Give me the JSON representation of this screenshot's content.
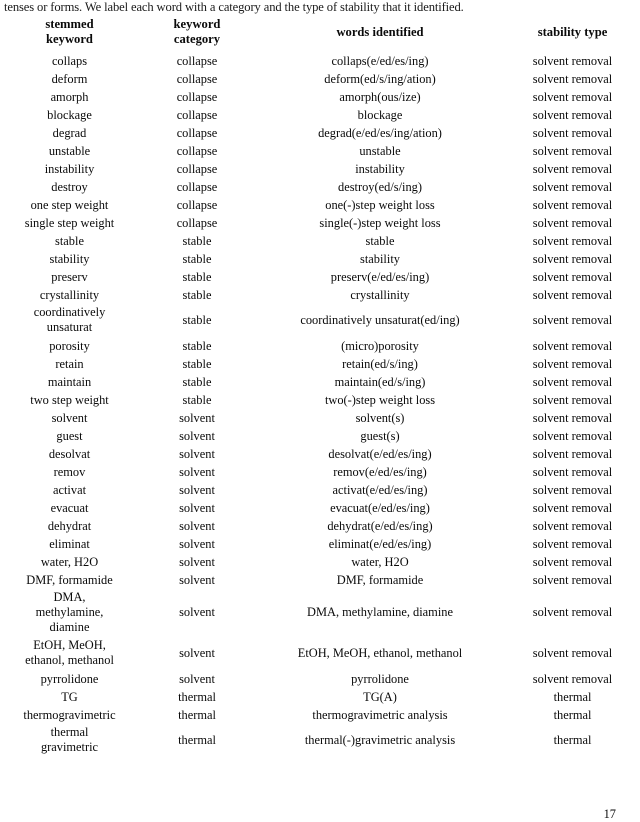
{
  "document": {
    "caption_text": "tenses or forms.  We label each word with a category and the type of stability that it identified.",
    "page_number": "17"
  },
  "table": {
    "columns": [
      {
        "key": "stemmed_keyword",
        "header": "stemmed\nkeyword"
      },
      {
        "key": "keyword_category",
        "header": "keyword\ncategory"
      },
      {
        "key": "words_identified",
        "header": "words identified"
      },
      {
        "key": "stability_type",
        "header": "stability type"
      }
    ],
    "groups": [
      {
        "name": "collapse",
        "rows": [
          {
            "stemmed_keyword": "collaps",
            "keyword_category": "collapse",
            "words_identified": "collaps(e/ed/es/ing)",
            "stability_type": "solvent removal"
          },
          {
            "stemmed_keyword": "deform",
            "keyword_category": "collapse",
            "words_identified": "deform(ed/s/ing/ation)",
            "stability_type": "solvent removal"
          },
          {
            "stemmed_keyword": "amorph",
            "keyword_category": "collapse",
            "words_identified": "amorph(ous/ize)",
            "stability_type": "solvent removal"
          },
          {
            "stemmed_keyword": "blockage",
            "keyword_category": "collapse",
            "words_identified": "blockage",
            "stability_type": "solvent removal"
          },
          {
            "stemmed_keyword": "degrad",
            "keyword_category": "collapse",
            "words_identified": "degrad(e/ed/es/ing/ation)",
            "stability_type": "solvent removal"
          },
          {
            "stemmed_keyword": "unstable",
            "keyword_category": "collapse",
            "words_identified": "unstable",
            "stability_type": "solvent removal"
          },
          {
            "stemmed_keyword": "instability",
            "keyword_category": "collapse",
            "words_identified": "instability",
            "stability_type": "solvent removal"
          },
          {
            "stemmed_keyword": "destroy",
            "keyword_category": "collapse",
            "words_identified": "destroy(ed/s/ing)",
            "stability_type": "solvent removal"
          },
          {
            "stemmed_keyword": "one step weight",
            "keyword_category": "collapse",
            "words_identified": "one(-)step weight loss",
            "stability_type": "solvent removal"
          },
          {
            "stemmed_keyword": "single step weight",
            "keyword_category": "collapse",
            "words_identified": "single(-)step weight loss",
            "stability_type": "solvent removal"
          }
        ]
      },
      {
        "name": "stable",
        "rows": [
          {
            "stemmed_keyword": "stable",
            "keyword_category": "stable",
            "words_identified": "stable",
            "stability_type": "solvent removal"
          },
          {
            "stemmed_keyword": "stability",
            "keyword_category": "stable",
            "words_identified": "stability",
            "stability_type": "solvent removal"
          },
          {
            "stemmed_keyword": "preserv",
            "keyword_category": "stable",
            "words_identified": "preserv(e/ed/es/ing)",
            "stability_type": "solvent removal"
          },
          {
            "stemmed_keyword": "crystallinity",
            "keyword_category": "stable",
            "words_identified": "crystallinity",
            "stability_type": "solvent removal"
          },
          {
            "stemmed_keyword": "coordinatively\nunsaturat",
            "keyword_category": "stable",
            "words_identified": "coordinatively unsaturat(ed/ing)",
            "stability_type": "solvent removal",
            "tall": true
          },
          {
            "stemmed_keyword": "porosity",
            "keyword_category": "stable",
            "words_identified": "(micro)porosity",
            "stability_type": "solvent removal"
          },
          {
            "stemmed_keyword": "retain",
            "keyword_category": "stable",
            "words_identified": "retain(ed/s/ing)",
            "stability_type": "solvent removal"
          },
          {
            "stemmed_keyword": "maintain",
            "keyword_category": "stable",
            "words_identified": "maintain(ed/s/ing)",
            "stability_type": "solvent removal"
          },
          {
            "stemmed_keyword": "two step weight",
            "keyword_category": "stable",
            "words_identified": "two(-)step weight loss",
            "stability_type": "solvent removal"
          }
        ]
      },
      {
        "name": "solvent",
        "rows": [
          {
            "stemmed_keyword": "solvent",
            "keyword_category": "solvent",
            "words_identified": "solvent(s)",
            "stability_type": "solvent removal"
          },
          {
            "stemmed_keyword": "guest",
            "keyword_category": "solvent",
            "words_identified": "guest(s)",
            "stability_type": "solvent removal"
          },
          {
            "stemmed_keyword": "desolvat",
            "keyword_category": "solvent",
            "words_identified": "desolvat(e/ed/es/ing)",
            "stability_type": "solvent removal"
          },
          {
            "stemmed_keyword": "remov",
            "keyword_category": "solvent",
            "words_identified": "remov(e/ed/es/ing)",
            "stability_type": "solvent removal"
          },
          {
            "stemmed_keyword": "activat",
            "keyword_category": "solvent",
            "words_identified": "activat(e/ed/es/ing)",
            "stability_type": "solvent removal"
          },
          {
            "stemmed_keyword": "evacuat",
            "keyword_category": "solvent",
            "words_identified": "evacuat(e/ed/es/ing)",
            "stability_type": "solvent removal"
          },
          {
            "stemmed_keyword": "dehydrat",
            "keyword_category": "solvent",
            "words_identified": "dehydrat(e/ed/es/ing)",
            "stability_type": "solvent removal"
          },
          {
            "stemmed_keyword": "eliminat",
            "keyword_category": "solvent",
            "words_identified": "eliminat(e/ed/es/ing)",
            "stability_type": "solvent removal"
          },
          {
            "stemmed_keyword": "water, H2O",
            "keyword_category": "solvent",
            "words_identified": "water, H2O",
            "stability_type": "solvent removal"
          },
          {
            "stemmed_keyword": "DMF, formamide",
            "keyword_category": "solvent",
            "words_identified": "DMF, formamide",
            "stability_type": "solvent removal"
          },
          {
            "stemmed_keyword": "DMA,\nmethylamine,\ndiamine",
            "keyword_category": "solvent",
            "words_identified": "DMA, methylamine, diamine",
            "stability_type": "solvent removal",
            "tall": true
          },
          {
            "stemmed_keyword": "EtOH, MeOH,\nethanol, methanol",
            "keyword_category": "solvent",
            "words_identified": "EtOH, MeOH, ethanol, methanol",
            "stability_type": "solvent removal",
            "tall": true
          },
          {
            "stemmed_keyword": "pyrrolidone",
            "keyword_category": "solvent",
            "words_identified": "pyrrolidone",
            "stability_type": "solvent removal"
          }
        ]
      },
      {
        "name": "thermal",
        "rows": [
          {
            "stemmed_keyword": "TG",
            "keyword_category": "thermal",
            "words_identified": "TG(A)",
            "stability_type": "thermal"
          },
          {
            "stemmed_keyword": "thermogravimetric",
            "keyword_category": "thermal",
            "words_identified": "thermogravimetric analysis",
            "stability_type": "thermal"
          },
          {
            "stemmed_keyword": "thermal\ngravimetric",
            "keyword_category": "thermal",
            "words_identified": "thermal(-)gravimetric analysis",
            "stability_type": "thermal",
            "tall": true
          }
        ]
      }
    ]
  }
}
